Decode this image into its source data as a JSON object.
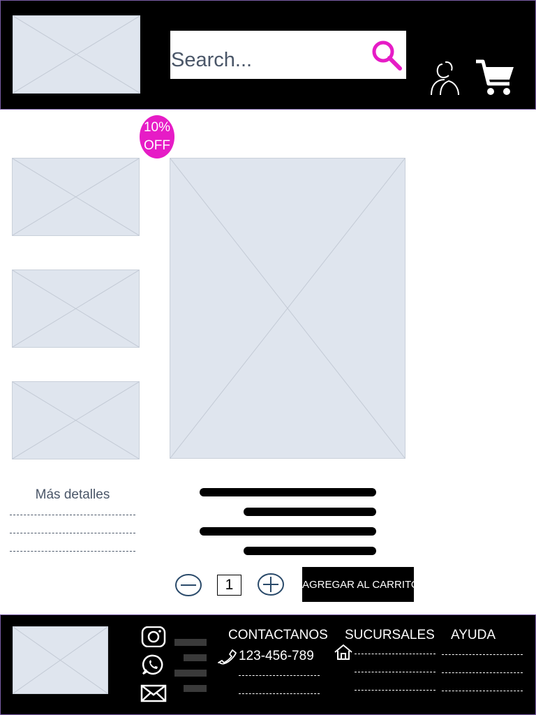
{
  "header": {
    "logo": "image-placeholder",
    "search": {
      "placeholder": "Search...",
      "value": ""
    },
    "search_icon": "search-icon",
    "user_icon": "user-icon",
    "cart_icon": "cart-icon"
  },
  "product": {
    "discount_badge": {
      "line1": "10%",
      "line2": "OFF"
    },
    "thumbnails": [
      "image-placeholder",
      "image-placeholder",
      "image-placeholder"
    ],
    "main_image": "image-placeholder",
    "details_title": "Más detalles",
    "quantity": "1",
    "add_to_cart_label": "AGREGAR AL CARRITO"
  },
  "footer": {
    "logo": "image-placeholder",
    "social_icons": [
      "instagram-icon",
      "whatsapp-icon",
      "mail-icon"
    ],
    "contact": {
      "heading": "CONTACTANOS",
      "phone": "123-456-789"
    },
    "branches": {
      "heading": "SUCURSALES",
      "icon": "home-icon"
    },
    "help": {
      "heading": "AYUDA"
    }
  },
  "colors": {
    "accent": "#e61cc6",
    "header_bg": "#000000",
    "placeholder": "#dfe5ee",
    "text_muted": "#4a5668",
    "icon_outline": "#2a4a6a"
  }
}
